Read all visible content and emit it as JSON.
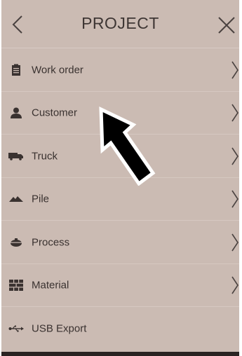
{
  "header": {
    "title": "PROJECT",
    "back_icon": "chevron-left-icon",
    "close_icon": "close-icon"
  },
  "menu": {
    "items": [
      {
        "label": "Work order",
        "icon": "clipboard-icon",
        "has_chevron": true
      },
      {
        "label": "Customer",
        "icon": "person-icon",
        "has_chevron": true
      },
      {
        "label": "Truck",
        "icon": "truck-icon",
        "has_chevron": true
      },
      {
        "label": "Pile",
        "icon": "pile-icon",
        "has_chevron": true
      },
      {
        "label": "Process",
        "icon": "process-icon",
        "has_chevron": true
      },
      {
        "label": "Material",
        "icon": "material-icon",
        "has_chevron": true
      },
      {
        "label": "USB Export",
        "icon": "usb-icon",
        "has_chevron": false
      }
    ]
  },
  "colors": {
    "background": "#cbbbb3",
    "text": "#3a3230",
    "icon": "#3a3230",
    "divider": "#d6c8c1",
    "arrow": "#000000"
  }
}
